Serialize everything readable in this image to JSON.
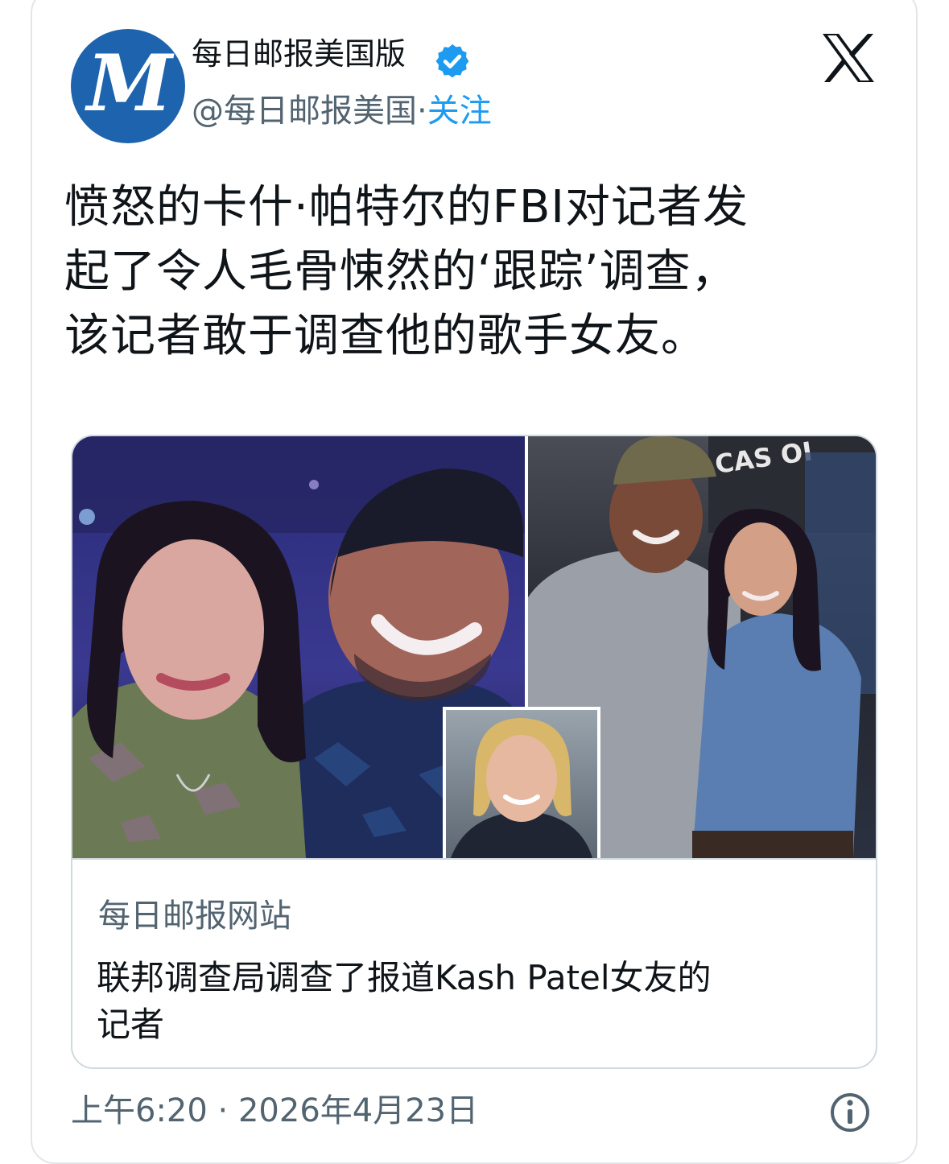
{
  "author": {
    "display_name": "每日邮报美国版",
    "handle": "@每日邮报美国",
    "separator": "·",
    "follow_label": "关注",
    "avatar_letters": "M",
    "verified_icon": "verified-badge-icon",
    "avatar_color": "#1e63ad"
  },
  "tweet": {
    "text_line1": "愤怒的卡什·帕特尔的FBI对记者发",
    "text_line2": "起了令人毛骨悚然的‘跟踪’调查，",
    "text_line3": "该记者敢于调查他的歌手女友。"
  },
  "card": {
    "domain": "每日邮报网站",
    "title_line1": "联邦调查局调查了报道Kash Patel女友的",
    "title_line2": "记者",
    "photo_sign": "CAS OI"
  },
  "footer": {
    "timestamp": "上午6:20 · 2026年4月23日",
    "info_icon": "info-icon"
  },
  "colors": {
    "accent": "#1d9bf0",
    "text": "#0f1419",
    "muted": "#536471",
    "border": "#cfd9de"
  }
}
